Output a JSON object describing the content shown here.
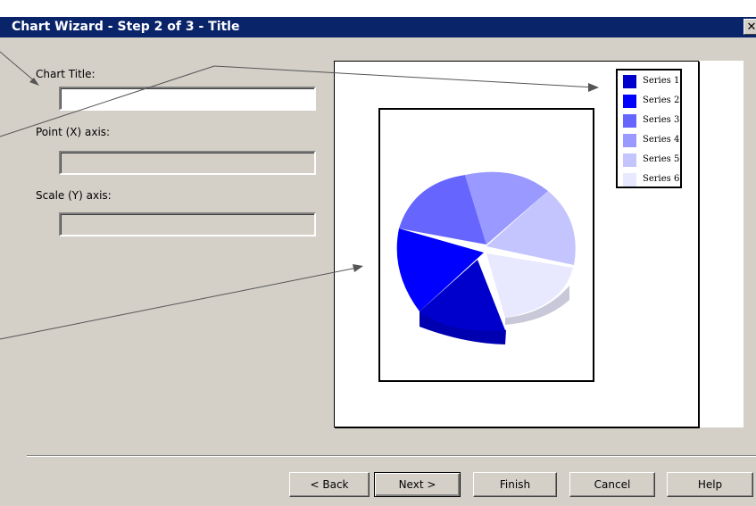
{
  "window": {
    "title": "Chart Wizard - Step 2 of 3 - Title",
    "close_glyph": "✕"
  },
  "form": {
    "chart_title_label": "Chart Title:",
    "chart_title_value": "",
    "x_axis_label": "Point (X) axis:",
    "x_axis_value": "",
    "y_axis_label": "Scale (Y) axis:",
    "y_axis_value": ""
  },
  "preview": {
    "legend": [
      {
        "label": "Series 1",
        "color": "#0000cc"
      },
      {
        "label": "Series 2",
        "color": "#0000ff"
      },
      {
        "label": "Series 3",
        "color": "#6666ff"
      },
      {
        "label": "Series 4",
        "color": "#9999ff"
      },
      {
        "label": "Series 5",
        "color": "#c4c4ff"
      },
      {
        "label": "Series 6",
        "color": "#e8e8ff"
      }
    ]
  },
  "buttons": {
    "back": "< Back",
    "next": "Next >",
    "finish": "Finish",
    "cancel": "Cancel",
    "help": "Help"
  }
}
